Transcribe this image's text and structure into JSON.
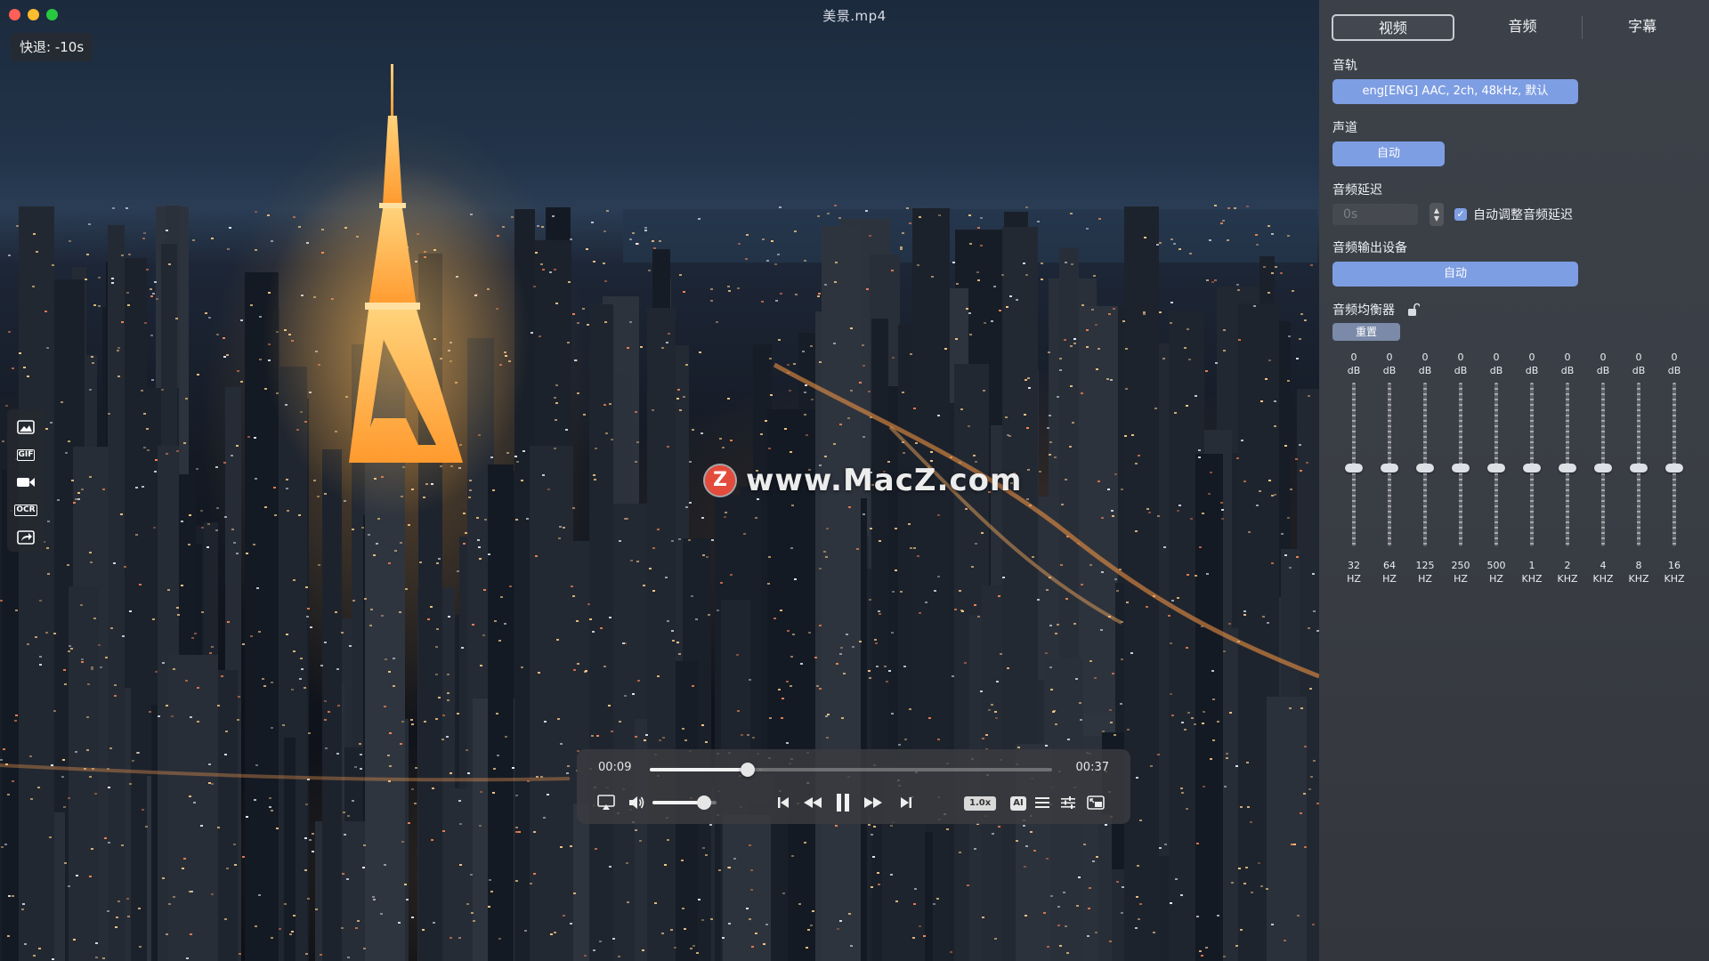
{
  "window": {
    "title": "美景.mp4"
  },
  "osd": {
    "text": "快退: -10s"
  },
  "side_tools": [
    {
      "name": "screenshot-icon",
      "label": ""
    },
    {
      "name": "gif-icon",
      "label": "GIF"
    },
    {
      "name": "record-icon",
      "label": ""
    },
    {
      "name": "ocr-icon",
      "label": "OCR"
    },
    {
      "name": "share-icon",
      "label": ""
    }
  ],
  "watermark": {
    "badge": "Z",
    "text": "www.MacZ.com"
  },
  "player": {
    "current_time": "00:09",
    "duration": "00:37",
    "progress": 0.243,
    "volume": 0.8,
    "speed": "1.0x",
    "ai_label": "AI"
  },
  "panel": {
    "tabs": [
      {
        "label": "视频",
        "active": true
      },
      {
        "label": "音频",
        "active": false
      },
      {
        "label": "字幕",
        "active": false
      }
    ],
    "audio_track": {
      "label": "音轨",
      "value": "eng[ENG] AAC, 2ch, 48kHz, 默认"
    },
    "channel": {
      "label": "声道",
      "value": "自动"
    },
    "delay": {
      "label": "音频延迟",
      "placeholder": "0s",
      "auto_label": "自动调整音频延迟",
      "auto_checked": true
    },
    "output": {
      "label": "音频输出设备",
      "value": "自动"
    },
    "equalizer": {
      "label": "音频均衡器",
      "reset_label": "重置",
      "bands": [
        {
          "value": "0",
          "unit": "dB",
          "freq": "32",
          "freq_unit": "HZ"
        },
        {
          "value": "0",
          "unit": "dB",
          "freq": "64",
          "freq_unit": "HZ"
        },
        {
          "value": "0",
          "unit": "dB",
          "freq": "125",
          "freq_unit": "HZ"
        },
        {
          "value": "0",
          "unit": "dB",
          "freq": "250",
          "freq_unit": "HZ"
        },
        {
          "value": "0",
          "unit": "dB",
          "freq": "500",
          "freq_unit": "HZ"
        },
        {
          "value": "0",
          "unit": "dB",
          "freq": "1",
          "freq_unit": "KHZ"
        },
        {
          "value": "0",
          "unit": "dB",
          "freq": "2",
          "freq_unit": "KHZ"
        },
        {
          "value": "0",
          "unit": "dB",
          "freq": "4",
          "freq_unit": "KHZ"
        },
        {
          "value": "0",
          "unit": "dB",
          "freq": "8",
          "freq_unit": "KHZ"
        },
        {
          "value": "0",
          "unit": "dB",
          "freq": "16",
          "freq_unit": "KHZ"
        }
      ]
    }
  },
  "colors": {
    "accent": "#7e9ee3",
    "panel_bg": "#3a3e45",
    "tower": "#ffb347"
  }
}
